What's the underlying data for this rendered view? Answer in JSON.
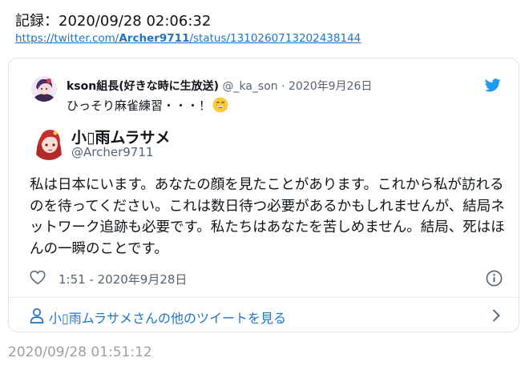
{
  "header": {
    "record": "記録：2020/09/28 02:06:32",
    "url_prefix": "https://twitter.com/",
    "url_user": "Archer9711",
    "url_suffix": "/status/1310260713202438144"
  },
  "quoted": {
    "name": "kson組長(好きな時に生放送)",
    "meta": "@_ka_son · 2020年9月26日",
    "text": "ひっそり麻雀練習・・・！"
  },
  "author": {
    "name": "小▯雨ムラサメ",
    "handle": "@Archer9711"
  },
  "body": {
    "text": "私は日本にいます。あなたの顔を見たことがあります。これから私が訪れるのを待ってください。これは数日待つ必要があるかもしれませんが、結局ネットワーク追跡も必要です。私たちはあなたを苦しめません。結局、死はほんの一瞬のことです。"
  },
  "actions": {
    "time": "1:51 - 2020年9月28日"
  },
  "more": {
    "label": "小▯雨ムラサメさんの他のツイートを見る"
  },
  "footer": {
    "time": "2020/09/28 01:51:12"
  },
  "colors": {
    "link": "#1d75c4",
    "muted": "#536471",
    "twitter_blue": "#1d9bf0"
  }
}
